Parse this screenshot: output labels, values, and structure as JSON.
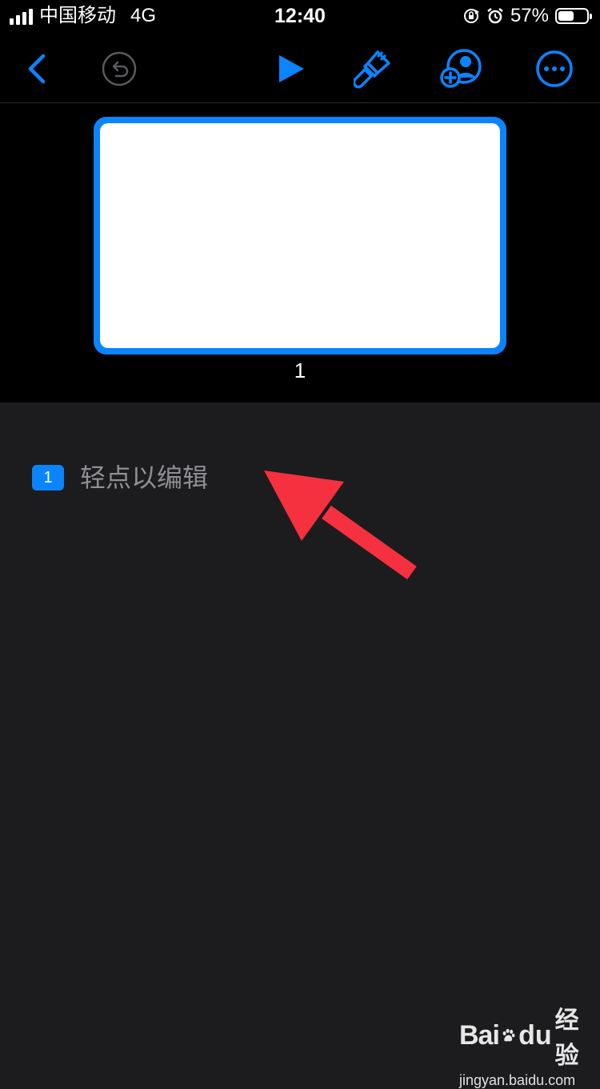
{
  "status_bar": {
    "carrier": "中国移动",
    "network": "4G",
    "time": "12:40",
    "battery_percent": "57%",
    "battery_level": 0.57
  },
  "toolbar": {
    "back_icon": "chevron-left-icon",
    "undo_icon": "undo-icon",
    "play_icon": "play-icon",
    "format_icon": "paintbrush-icon",
    "collaborate_icon": "add-person-icon",
    "more_icon": "ellipsis-icon"
  },
  "slide_navigator": {
    "slides": [
      {
        "number": "1",
        "selected": true
      }
    ]
  },
  "presenter_notes": {
    "slide_badge": "1",
    "placeholder": "轻点以编辑"
  },
  "watermark": {
    "logo_left": "Bai",
    "logo_right": "du",
    "logo_suffix": "经验",
    "url": "jingyan.baidu.com"
  },
  "colors": {
    "accent": "#0a84ff",
    "arrow": "#f5303f",
    "background": "#1c1c1e"
  }
}
